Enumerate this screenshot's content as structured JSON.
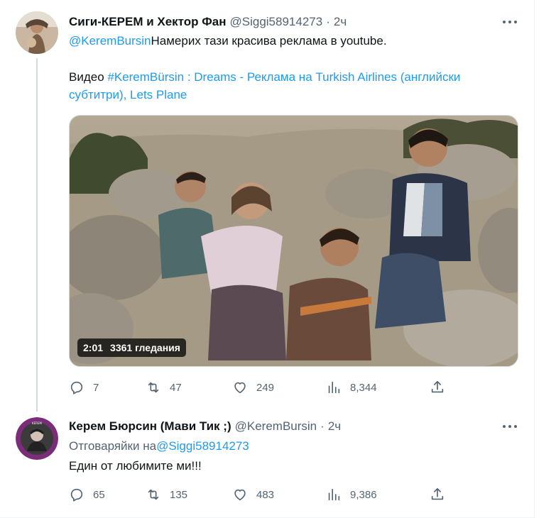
{
  "tweet1": {
    "author_name": "Сиги-КЕРЕМ и Хектор Фан",
    "handle": "@Siggi58914273",
    "dot": "·",
    "time": "2ч",
    "mention": "@KeremBursin",
    "text_after_mention": "Намерих тази красива реклама в youtube.",
    "line2_prefix": "Видео ",
    "line2_link": "#KeremBürsin : Dreams - Реклама на Turkish Airlines (английски субтитри), Lets Plane",
    "video": {
      "duration": "2:01",
      "views": "3361 гледания"
    },
    "stats": {
      "replies": "7",
      "retweets": "47",
      "likes": "249",
      "views": "8,344"
    }
  },
  "tweet2": {
    "author_name": "Керем Бюрсин (Мави Тик ;)",
    "handle": "@KeremBursin",
    "dot": "·",
    "time": "2ч",
    "reply_prefix": "Отговаряйки на",
    "reply_handle": "@Siggi58914273",
    "text": "Един от любимите ми!!!",
    "stats": {
      "replies": "65",
      "retweets": "135",
      "likes": "483",
      "views": "9,386"
    }
  },
  "icons": [
    "reply-icon",
    "retweet-icon",
    "like-icon",
    "views-icon",
    "share-icon",
    "more-icon"
  ],
  "colors": {
    "link": "#1d9bf0",
    "muted": "#536471",
    "text": "#0f1419"
  }
}
